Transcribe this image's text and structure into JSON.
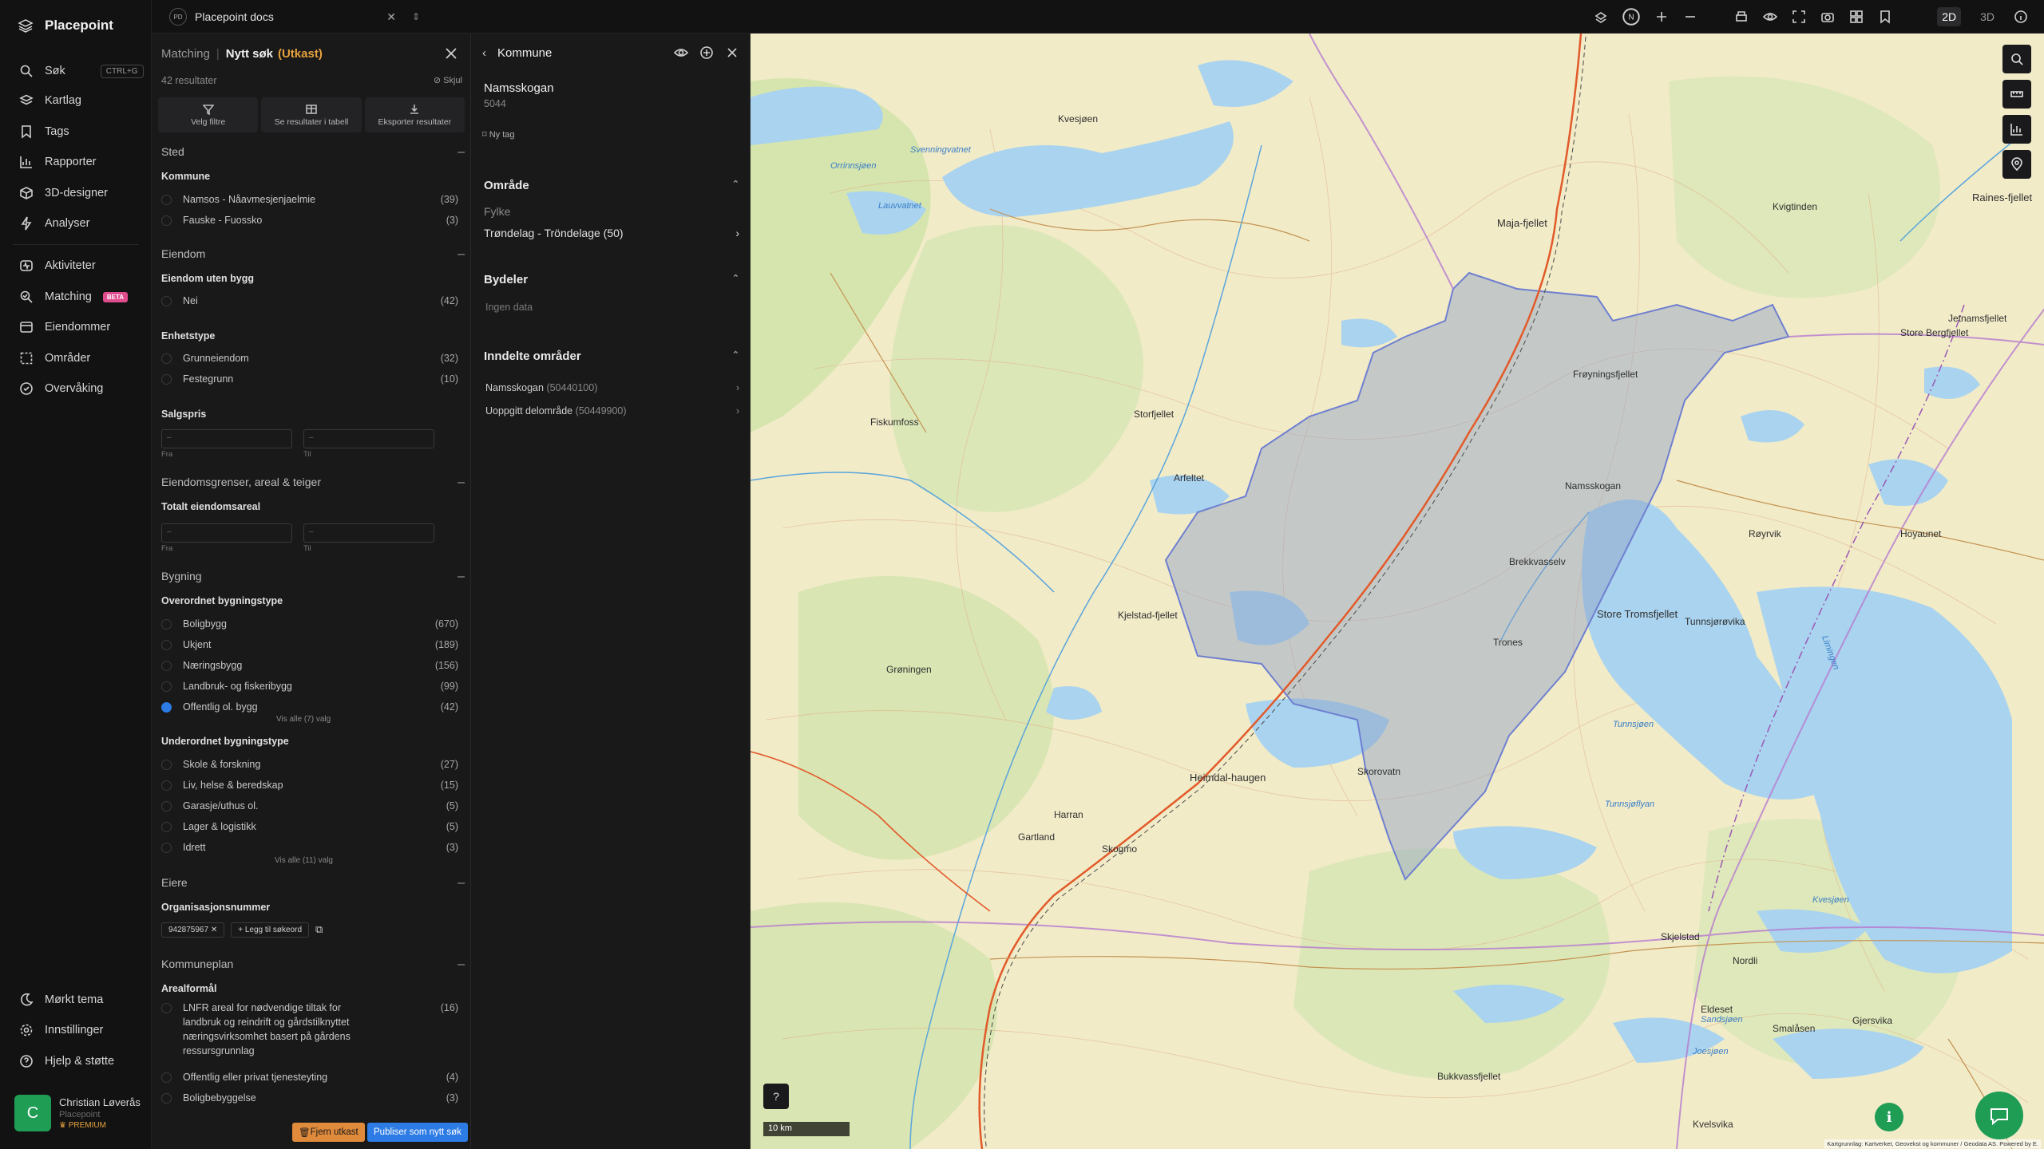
{
  "app": {
    "name": "Placepoint",
    "doc_pill": "Placepoint docs",
    "doc_badge": "PD"
  },
  "nav": {
    "items": [
      {
        "label": "Søk",
        "shortcut": "CTRL+G",
        "icon": "search-icon"
      },
      {
        "label": "Kartlag",
        "icon": "layers-icon"
      },
      {
        "label": "Tags",
        "icon": "bookmark-icon"
      },
      {
        "label": "Rapporter",
        "icon": "chart-icon"
      },
      {
        "label": "3D-designer",
        "icon": "cube-icon"
      },
      {
        "label": "Analyser",
        "icon": "bolt-icon"
      },
      {
        "label": "Aktiviteter",
        "icon": "activity-icon"
      },
      {
        "label": "Matching",
        "badge": "BETA",
        "icon": "match-icon"
      },
      {
        "label": "Eiendommer",
        "icon": "property-icon"
      },
      {
        "label": "Områder",
        "icon": "area-icon"
      },
      {
        "label": "Overvåking",
        "icon": "monitor-icon"
      }
    ],
    "bottom": [
      {
        "label": "Mørkt tema",
        "icon": "moon-icon"
      },
      {
        "label": "Innstillinger",
        "icon": "gear-icon"
      },
      {
        "label": "Hjelp & støtte",
        "icon": "help-icon"
      }
    ],
    "user": {
      "initial": "C",
      "name": "Christian Løverås",
      "org": "Placepoint",
      "plan": "PREMIUM"
    }
  },
  "topbar": {
    "mode_2d": "2D",
    "mode_3d": "3D",
    "north": "N"
  },
  "search": {
    "crumb": "Matching",
    "title": "Nytt søk",
    "status": "(Utkast)",
    "results": "42 resultater",
    "hide": "Skjul",
    "actions": [
      "Velg filtre",
      "Se resultater i tabell",
      "Eksporter resultater"
    ],
    "sted": {
      "title": "Sted",
      "kommune_label": "Kommune",
      "options": [
        {
          "label": "Namsos - Nåavmesjenjaelmie",
          "count": "(39)"
        },
        {
          "label": "Fauske - Fuossko",
          "count": "(3)"
        }
      ]
    },
    "eiendom": {
      "title": "Eiendom",
      "uten_bygg_label": "Eiendom uten bygg",
      "uten_bygg": [
        {
          "label": "Nei",
          "count": "(42)"
        }
      ],
      "enhetstype_label": "Enhetstype",
      "enhetstype": [
        {
          "label": "Grunneiendom",
          "count": "(32)"
        },
        {
          "label": "Festegrunn",
          "count": "(10)"
        }
      ],
      "salgspris_label": "Salgspris",
      "from": "Fra",
      "to": "Til",
      "dash": "–"
    },
    "grenser": {
      "title": "Eiendomsgrenser, areal & teiger",
      "totalt_label": "Totalt eiendomsareal"
    },
    "bygning": {
      "title": "Bygning",
      "over_label": "Overordnet bygningstype",
      "over": [
        {
          "label": "Boligbygg",
          "count": "(670)",
          "checked": false
        },
        {
          "label": "Ukjent",
          "count": "(189)",
          "checked": false
        },
        {
          "label": "Næringsbygg",
          "count": "(156)",
          "checked": false
        },
        {
          "label": "Landbruk- og fiskeribygg",
          "count": "(99)",
          "checked": false
        },
        {
          "label": "Offentlig ol. bygg",
          "count": "(42)",
          "checked": true
        }
      ],
      "over_more": "Vis alle (7) valg",
      "under_label": "Underordnet bygningstype",
      "under": [
        {
          "label": "Skole & forskning",
          "count": "(27)"
        },
        {
          "label": "Liv, helse & beredskap",
          "count": "(15)"
        },
        {
          "label": "Garasje/uthus ol.",
          "count": "(5)"
        },
        {
          "label": "Lager & logistikk",
          "count": "(5)"
        },
        {
          "label": "Idrett",
          "count": "(3)"
        }
      ],
      "under_more": "Vis alle (11) valg"
    },
    "eiere": {
      "title": "Eiere",
      "org_label": "Organisasjonsnummer",
      "chip": "942875967",
      "add": "Legg til søkeord"
    },
    "kommuneplan": {
      "title": "Kommuneplan",
      "areal_label": "Arealformål",
      "items": [
        {
          "label": "LNFR areal for nødvendige tiltak for landbruk og reindrift og gårdstilknyttet næringsvirksomhet basert på gårdens ressursgrunnlag",
          "count": "(16)"
        },
        {
          "label": "Offentlig eller privat tjenesteyting",
          "count": "(4)"
        },
        {
          "label": "Boligbebyggelse",
          "count": "(3)"
        }
      ]
    },
    "footer": {
      "remove": "Fjern utkast",
      "publish": "Publiser som nytt søk"
    }
  },
  "detail": {
    "header": "Kommune",
    "name": "Namsskogan",
    "code": "5044",
    "tag": "Ny tag",
    "omrade": {
      "title": "Område",
      "fylke_label": "Fylke",
      "fylke": "Trøndelag - Tröndelage (50)"
    },
    "bydeler": {
      "title": "Bydeler",
      "empty": "Ingen data"
    },
    "inndelte": {
      "title": "Inndelte områder",
      "items": [
        {
          "name": "Namsskogan",
          "code": "(50440100)"
        },
        {
          "name": "Uoppgitt delområde",
          "code": "(50449900)"
        }
      ]
    }
  },
  "map": {
    "scale": "10 km",
    "attribution": "Kartgrunnlag: Kartverket, Geovekst og kommuner / Geodata AS. Powered by E.",
    "places": [
      "Kvesjøen",
      "Maja-fjellet",
      "Kvigtinden",
      "Raines-fjellet",
      "Store Bergfjellet",
      "Frøyningsfjellet",
      "Namsskogan",
      "Brekkvasselv",
      "Store Tromsfjellet",
      "Trones",
      "Tunnsjøen",
      "Heimdal-haugen",
      "Skorovatn",
      "Harran",
      "Gartland",
      "Skogmo",
      "Bukkvassfjellet",
      "Limingen",
      "Tunnsjøflyan",
      "Nordli",
      "Smalåsen",
      "Gjersvika",
      "Kvesjøen",
      "Skjelstad",
      "Eldeset",
      "Sandsjøen",
      "Joesjøen",
      "Orrinnsjøen",
      "Jetnamsfjellet",
      "Storfjellet",
      "Svenningvatnet",
      "Fiskumfoss",
      "Arfeltet",
      "Kjelstad-fjellet",
      "Grøningen",
      "Røyrvik",
      "Hoyaunet",
      "Tunnsjørøvika",
      "Lauvvatnet",
      "Kvelsvika"
    ]
  }
}
